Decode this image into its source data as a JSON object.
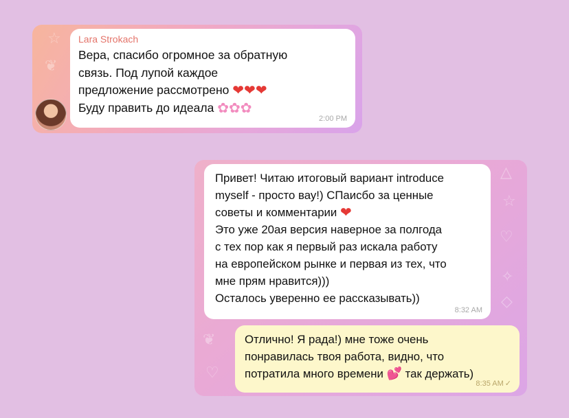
{
  "messages": [
    {
      "sender": "Lara Strokach",
      "lines": [
        "Вера, спасибо огромное за обратную",
        "связь. Под лупой каждое",
        "предложение рассмотрено",
        "Буду править до идеала"
      ],
      "emoji_hearts": "❤❤❤",
      "emoji_flowers": "✿✿✿",
      "time": "2:00 PM"
    },
    {
      "lines": [
        "Привет! Читаю итоговый вариант introduce",
        "myself - просто вау!) СПаисбо за ценные",
        "советы и комментарии",
        "Это уже 20ая версия наверное за полгода",
        "с тех пор как я первый раз искала работу",
        "на европейском рынке и первая из тех, что",
        "мне прям нравится)))",
        "Осталось уверенно ее рассказывать))"
      ],
      "emoji_heart": "❤",
      "time": "8:32 AM"
    },
    {
      "lines": [
        "Отлично! Я рада!) мне тоже очень",
        "понравилась твоя работа, видно, что",
        "потратила много времени",
        "так держать)"
      ],
      "emoji_hearts": "💕",
      "time": "8:35 AM",
      "status_icon": "✓"
    }
  ],
  "icons": {
    "avatar": "avatar-photo",
    "read_status": "check-icon"
  },
  "colors": {
    "page_background": "#e2bfe3",
    "sender_name": "#e4746a",
    "outgoing_bubble": "#fdf7cb",
    "incoming_bubble": "#ffffff"
  }
}
